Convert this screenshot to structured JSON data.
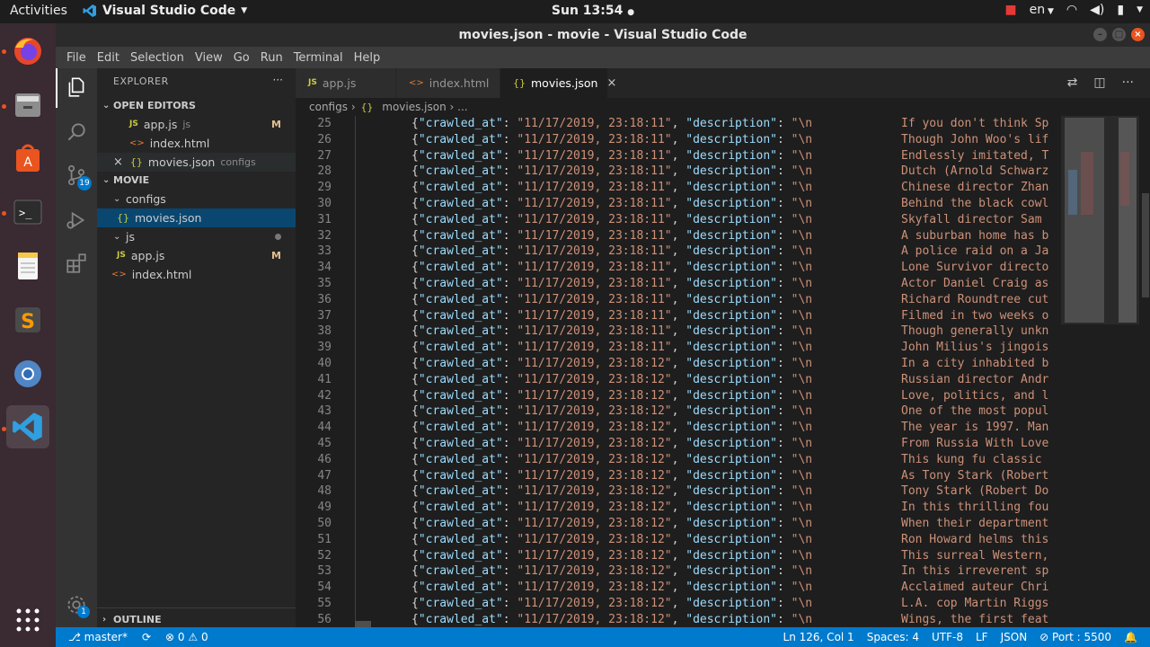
{
  "topbar": {
    "activities": "Activities",
    "app_name": "Visual Studio Code",
    "clock": "Sun 13:54",
    "locale": "en"
  },
  "window": {
    "title": "movies.json - movie - Visual Studio Code"
  },
  "menu": [
    "File",
    "Edit",
    "Selection",
    "View",
    "Go",
    "Run",
    "Terminal",
    "Help"
  ],
  "activity": {
    "scm_badge": "19",
    "settings_badge": "1"
  },
  "sidebar": {
    "title": "EXPLORER",
    "open_editors_label": "OPEN EDITORS",
    "open_editors": [
      {
        "name": "app.js",
        "hint": "js",
        "badge": "M"
      },
      {
        "name": "index.html",
        "hint": "",
        "badge": ""
      },
      {
        "name": "movies.json",
        "hint": "configs",
        "badge": ""
      }
    ],
    "project_label": "MOVIE",
    "tree": {
      "configs": "configs",
      "movies": "movies.json",
      "js": "js",
      "appjs": "app.js",
      "appjs_badge": "M",
      "index": "index.html"
    },
    "outline_label": "OUTLINE"
  },
  "tabs": [
    {
      "label": "app.js",
      "icon": "JS"
    },
    {
      "label": "index.html",
      "icon": "<>"
    },
    {
      "label": "movies.json",
      "icon": "{}"
    }
  ],
  "breadcrumb": {
    "folder": "configs",
    "file": "movies.json",
    "more": "..."
  },
  "editor": {
    "lines": [
      {
        "n": "25",
        "time": "23:18:11",
        "desc": "If you don't think Sp"
      },
      {
        "n": "26",
        "time": "23:18:11",
        "desc": "Though John Woo's lif"
      },
      {
        "n": "27",
        "time": "23:18:11",
        "desc": "Endlessly imitated, T"
      },
      {
        "n": "28",
        "time": "23:18:11",
        "desc": "Dutch (Arnold Schwarz"
      },
      {
        "n": "29",
        "time": "23:18:11",
        "desc": "Chinese director Zhan"
      },
      {
        "n": "30",
        "time": "23:18:11",
        "desc": "Behind the black cowl"
      },
      {
        "n": "31",
        "time": "23:18:11",
        "desc": "Skyfall director Sam "
      },
      {
        "n": "32",
        "time": "23:18:11",
        "desc": "A suburban home has b"
      },
      {
        "n": "33",
        "time": "23:18:11",
        "desc": "A police raid on a Ja"
      },
      {
        "n": "34",
        "time": "23:18:11",
        "desc": "Lone Survivor directo"
      },
      {
        "n": "35",
        "time": "23:18:11",
        "desc": "Actor Daniel Craig as"
      },
      {
        "n": "36",
        "time": "23:18:11",
        "desc": "Richard Roundtree cut"
      },
      {
        "n": "37",
        "time": "23:18:11",
        "desc": "Filmed in two weeks o"
      },
      {
        "n": "38",
        "time": "23:18:11",
        "desc": "Though generally unkn"
      },
      {
        "n": "39",
        "time": "23:18:11",
        "desc": "John Milius's jingois"
      },
      {
        "n": "40",
        "time": "23:18:12",
        "desc": "In a city inhabited b"
      },
      {
        "n": "41",
        "time": "23:18:12",
        "desc": "Russian director Andr"
      },
      {
        "n": "42",
        "time": "23:18:12",
        "desc": "Love, politics, and l"
      },
      {
        "n": "43",
        "time": "23:18:12",
        "desc": "One of the most popul"
      },
      {
        "n": "44",
        "time": "23:18:12",
        "desc": "The year is 1997. Man"
      },
      {
        "n": "45",
        "time": "23:18:12",
        "desc": "From Russia With Love"
      },
      {
        "n": "46",
        "time": "23:18:12",
        "desc": "This kung fu classic "
      },
      {
        "n": "47",
        "time": "23:18:12",
        "desc": "As Tony Stark (Robert"
      },
      {
        "n": "48",
        "time": "23:18:12",
        "desc": "Tony Stark (Robert Do"
      },
      {
        "n": "49",
        "time": "23:18:12",
        "desc": "In this thrilling fou"
      },
      {
        "n": "50",
        "time": "23:18:12",
        "desc": "When their department"
      },
      {
        "n": "51",
        "time": "23:18:12",
        "desc": "Ron Howard helms this"
      },
      {
        "n": "52",
        "time": "23:18:12",
        "desc": "This surreal Western,"
      },
      {
        "n": "53",
        "time": "23:18:12",
        "desc": "In this irreverent sp"
      },
      {
        "n": "54",
        "time": "23:18:12",
        "desc": "Acclaimed auteur Chri"
      },
      {
        "n": "55",
        "time": "23:18:12",
        "desc": "L.A. cop Martin Riggs"
      },
      {
        "n": "56",
        "time": "23:18:12",
        "desc": "Wings, the first feat"
      }
    ],
    "key_crawled": "\"crawled_at\"",
    "date": "11/17/2019",
    "key_desc": "\"description\"",
    "newline": "\"\\n"
  },
  "status": {
    "branch": "master*",
    "problems": "0",
    "warnings": "0",
    "position": "Ln 126, Col 1",
    "spaces": "Spaces: 4",
    "encoding": "UTF-8",
    "eol": "LF",
    "language": "JSON",
    "port": "Port : 5500"
  },
  "colors": {
    "accent": "#007acc",
    "selection": "#094771",
    "dock": "#3a2a32"
  }
}
